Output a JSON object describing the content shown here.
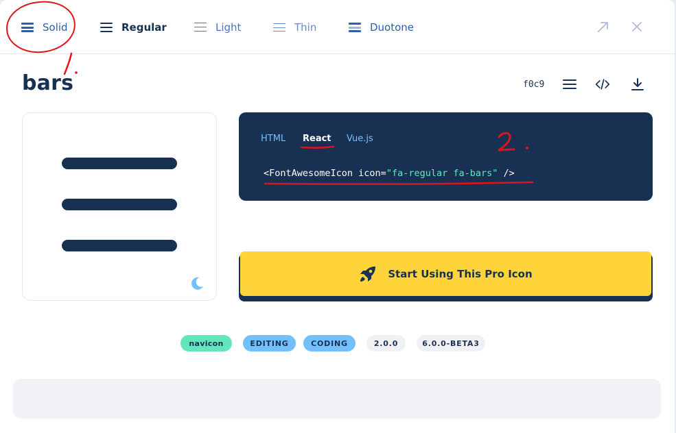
{
  "style_tabs": {
    "solid": "Solid",
    "regular": "Regular",
    "light": "Light",
    "thin": "Thin",
    "duotone": "Duotone"
  },
  "header_icons": [
    "expand-icon",
    "close-icon"
  ],
  "icon": {
    "name": "bars",
    "unicode": "f0c9"
  },
  "toolbar_icons": [
    "list-icon",
    "code-icon",
    "download-icon"
  ],
  "code": {
    "tabs": [
      "HTML",
      "React",
      "Vue.js"
    ],
    "active_tab": "React",
    "prefix": "<FontAwesomeIcon icon=",
    "value": "\"fa-regular fa-bars\"",
    "suffix": " />"
  },
  "cta": {
    "label": "Start Using This Pro Icon"
  },
  "tags": [
    "navicon",
    "EDITING",
    "CODING",
    "2.0.0",
    "6.0.0-BETA3"
  ],
  "annotations": {
    "mark1": "1.",
    "mark2": "2."
  },
  "colors": {
    "navy": "#183153",
    "accent_blue": "#2b5fa8",
    "cta_yellow": "#ffd43b",
    "tag_green": "#63e6be",
    "tag_blue": "#74c0fc",
    "annotation_red": "#e3121a"
  }
}
